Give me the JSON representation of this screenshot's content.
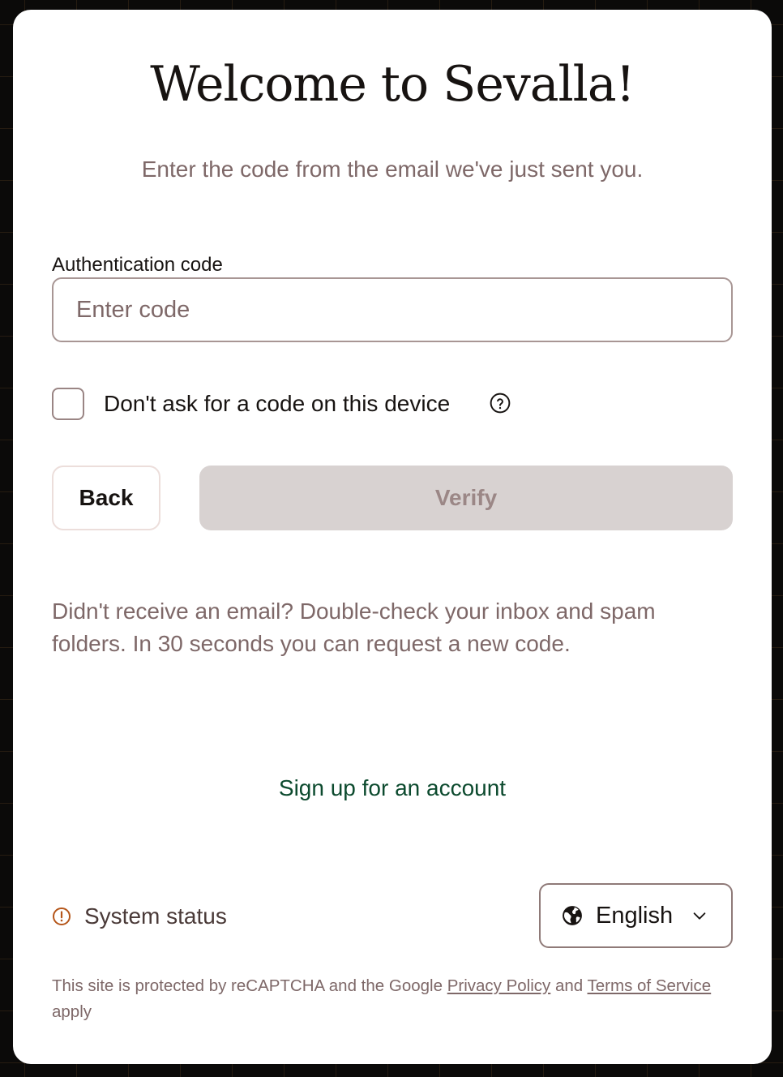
{
  "title": "Welcome to Sevalla!",
  "subtitle": "Enter the code from the email we've just sent you.",
  "auth_code": {
    "label": "Authentication code",
    "placeholder": "Enter code",
    "value": ""
  },
  "remember_device": {
    "label": "Don't ask for a code on this device",
    "checked": false,
    "help_icon": "question-circle-icon"
  },
  "buttons": {
    "back": "Back",
    "verify": "Verify"
  },
  "help_text": "Didn't receive an email? Double-check your inbox and spam folders. In 30 seconds you can request a new code.",
  "signup_link": "Sign up for an account",
  "footer": {
    "status_icon": "alert-circle-icon",
    "status_label": "System status",
    "language_icon": "globe-icon",
    "language": "English",
    "dropdown_icon": "chevron-down-icon"
  },
  "legal": {
    "prefix": "This site is protected by reCAPTCHA and the Google",
    "privacy": "Privacy Policy",
    "and": "and",
    "terms": "Terms of Service",
    "suffix": "apply"
  },
  "colors": {
    "text_primary": "#171311",
    "text_muted": "#7e6868",
    "link_green": "#0c4a2e",
    "verify_disabled_bg": "#d8d2d1",
    "status_accent": "#b5561a"
  }
}
